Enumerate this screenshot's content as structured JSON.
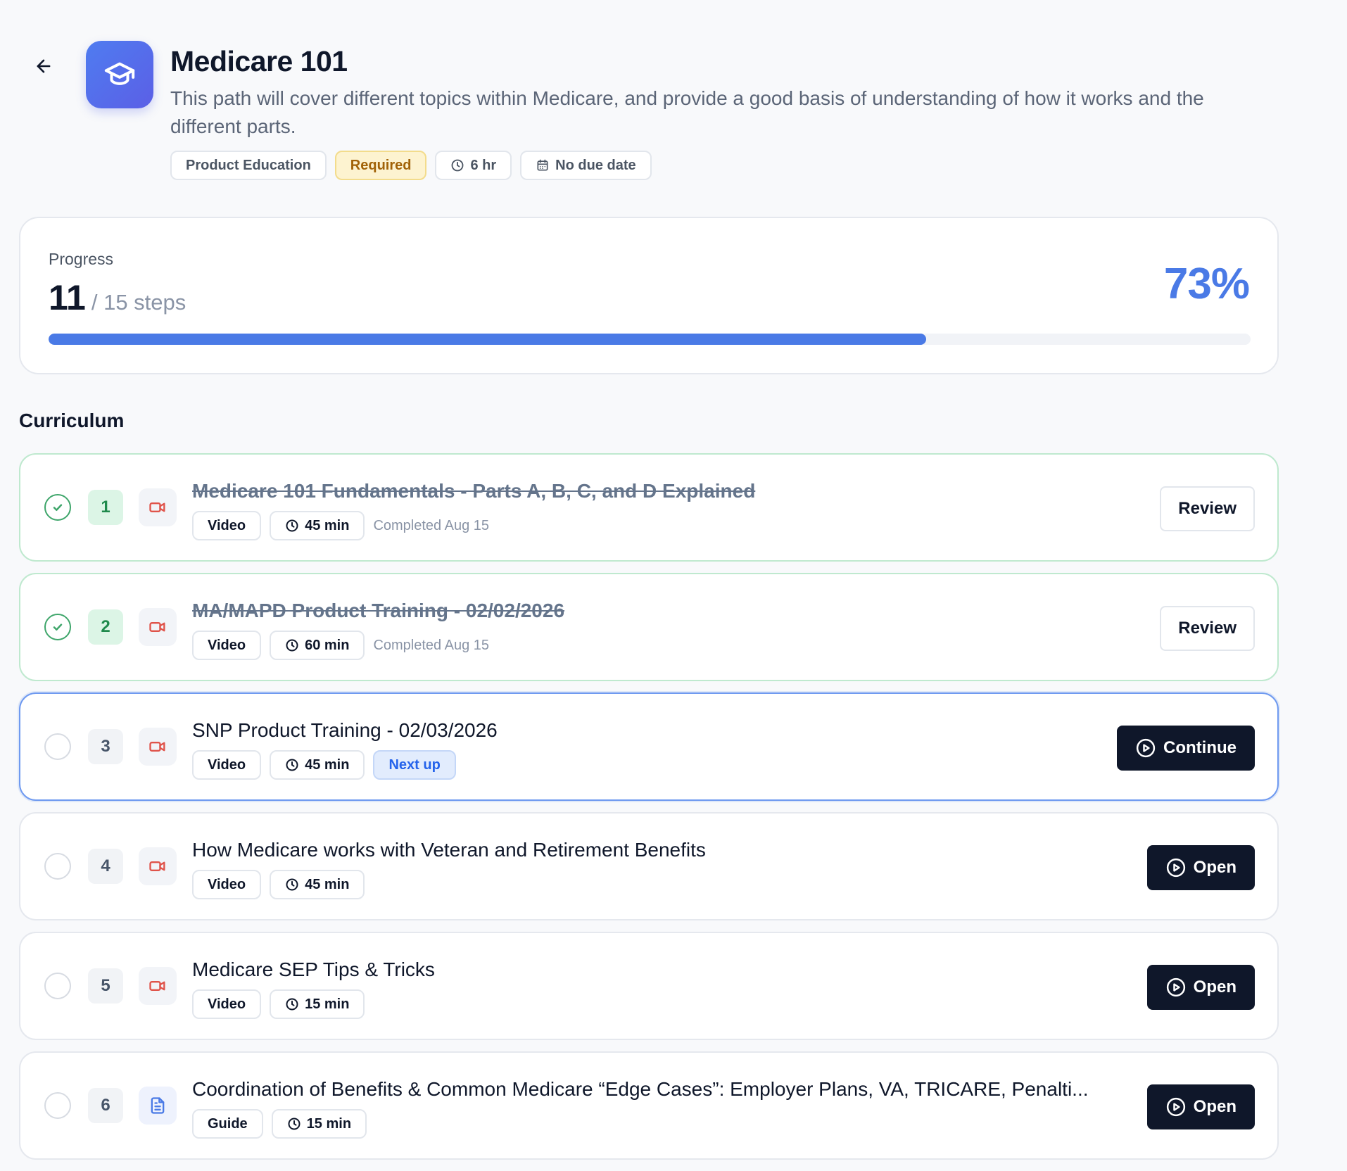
{
  "header": {
    "title": "Medicare 101",
    "description": "This path will cover different topics within Medicare, and provide a good basis of understanding of how it works and the different parts.",
    "tags": [
      {
        "label": "Product Education",
        "kind": "category"
      },
      {
        "label": "Required",
        "kind": "required"
      },
      {
        "label": "6 hr",
        "kind": "duration",
        "icon": "clock-icon"
      },
      {
        "label": "No due date",
        "kind": "due",
        "icon": "calendar-icon"
      }
    ]
  },
  "progress": {
    "label": "Progress",
    "completed": "11",
    "total_text": "/ 15 steps",
    "percent_text": "73%",
    "percent_value": 73
  },
  "curriculum": {
    "title": "Curriculum",
    "items": [
      {
        "number": "1",
        "title": "Medicare 101 Fundamentals - Parts A, B, C, and D Explained",
        "type": "Video",
        "duration": "45 min",
        "status": "completed",
        "status_text": "Completed Aug 15",
        "action": "Review"
      },
      {
        "number": "2",
        "title": "MA/MAPD Product Training - 02/02/2026",
        "type": "Video",
        "duration": "60 min",
        "status": "completed",
        "status_text": "Completed Aug 15",
        "action": "Review"
      },
      {
        "number": "3",
        "title": "SNP Product Training - 02/03/2026",
        "type": "Video",
        "duration": "45 min",
        "status": "current",
        "status_text": "Next up",
        "action": "Continue"
      },
      {
        "number": "4",
        "title": "How Medicare works with Veteran and Retirement Benefits",
        "type": "Video",
        "duration": "45 min",
        "status": "pending",
        "action": "Open"
      },
      {
        "number": "5",
        "title": "Medicare SEP Tips & Tricks",
        "type": "Video",
        "duration": "15 min",
        "status": "pending",
        "action": "Open"
      },
      {
        "number": "6",
        "title": "Coordination of Benefits & Common Medicare “Edge Cases”: Employer Plans, VA, TRICARE, Penalti...",
        "type": "Guide",
        "duration": "15 min",
        "status": "pending",
        "action": "Open"
      }
    ]
  },
  "colors": {
    "accent": "#4a7ae6",
    "success": "#3fa66b",
    "video_icon": "#e0534a",
    "guide_icon": "#4a7ae6",
    "dark_button": "#0f172a"
  }
}
